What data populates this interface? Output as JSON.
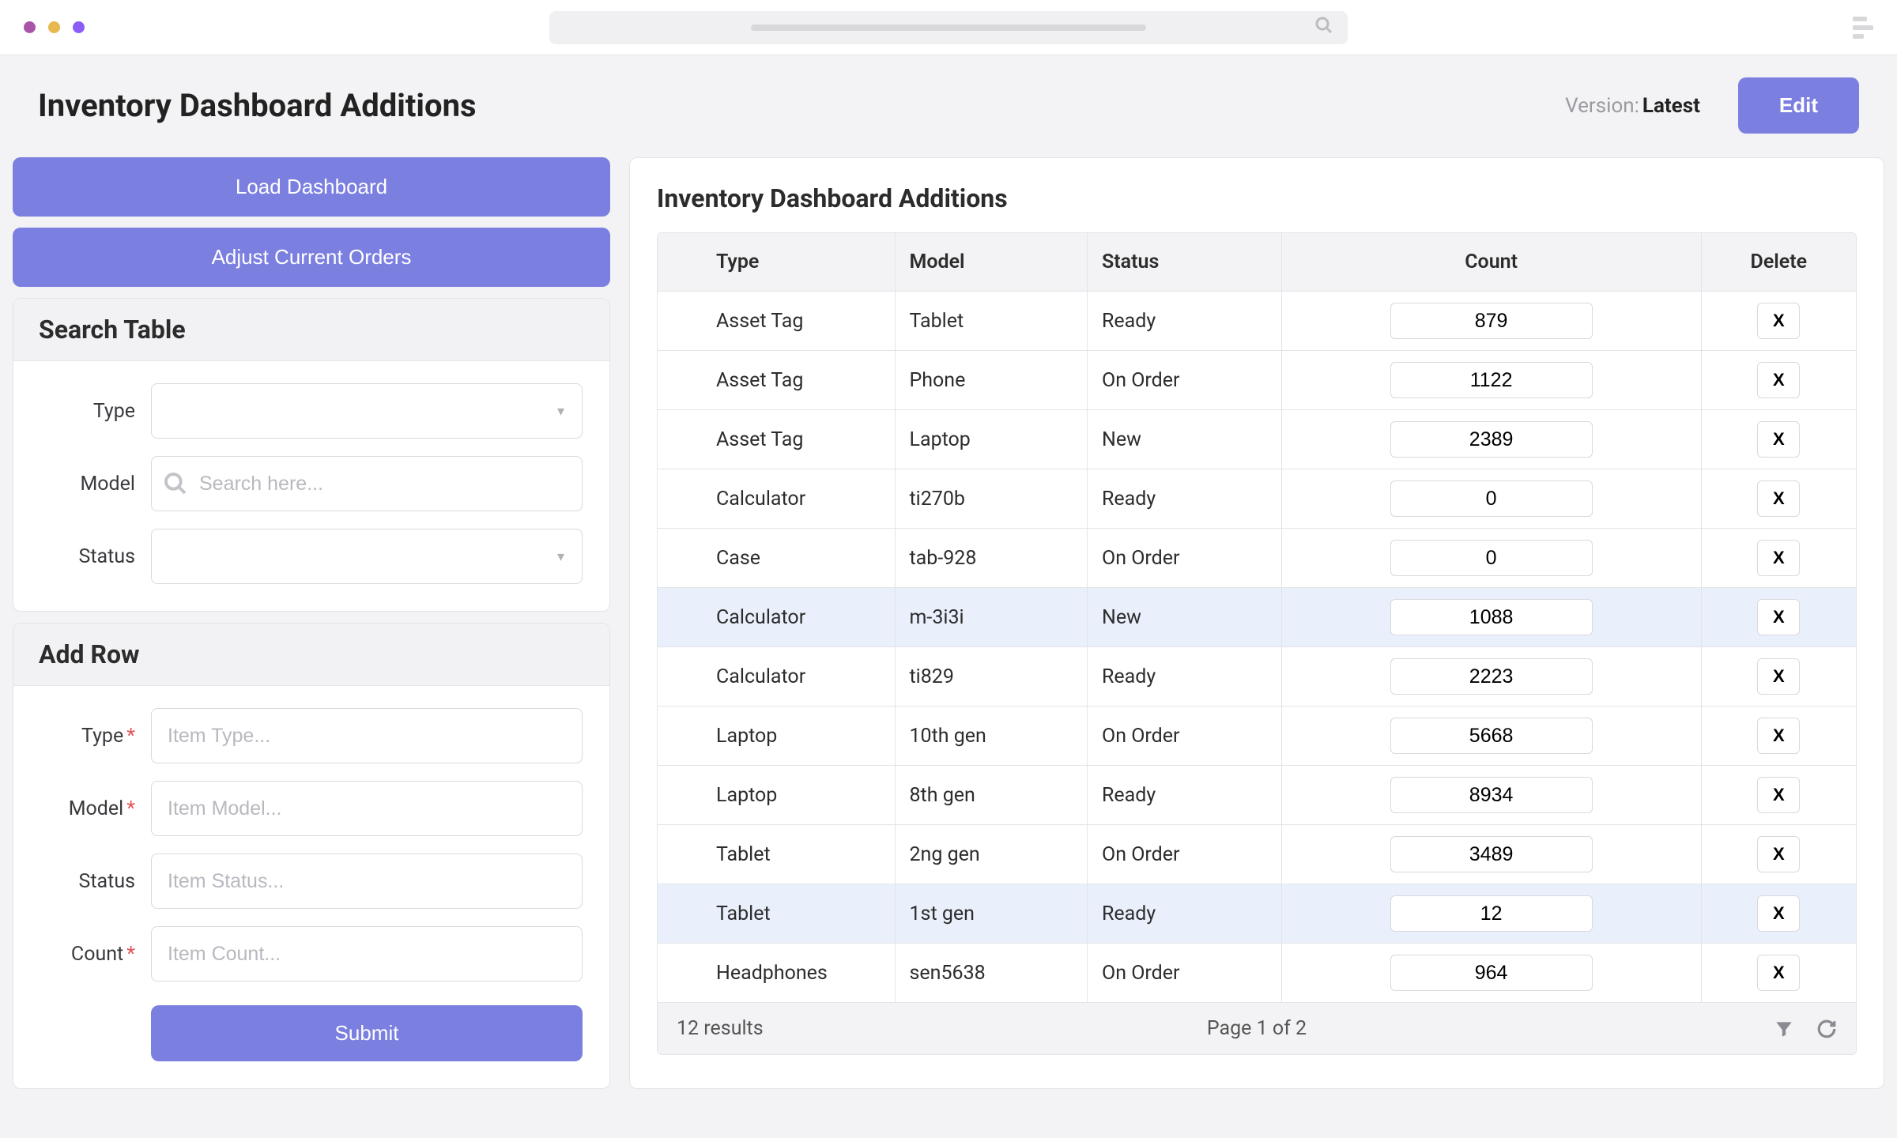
{
  "header": {
    "title": "Inventory Dashboard Additions",
    "version_label": "Version:",
    "version_value": "Latest",
    "edit_label": "Edit"
  },
  "sidebar": {
    "load_btn": "Load Dashboard",
    "adjust_btn": "Adjust Current Orders",
    "search": {
      "title": "Search Table",
      "type_label": "Type",
      "model_label": "Model",
      "model_placeholder": "Search here...",
      "status_label": "Status"
    },
    "addrow": {
      "title": "Add Row",
      "type_label": "Type",
      "type_placeholder": "Item Type...",
      "model_label": "Model",
      "model_placeholder": "Item Model...",
      "status_label": "Status",
      "status_placeholder": "Item Status...",
      "count_label": "Count",
      "count_placeholder": "Item Count...",
      "submit_label": "Submit"
    }
  },
  "main": {
    "title": "Inventory Dashboard Additions",
    "columns": [
      "Type",
      "Model",
      "Status",
      "Count",
      "Delete"
    ],
    "rows": [
      {
        "type": "Asset Tag",
        "model": "Tablet",
        "status": "Ready",
        "count": "879",
        "highlight": false
      },
      {
        "type": "Asset Tag",
        "model": "Phone",
        "status": "On Order",
        "count": "1122",
        "highlight": false
      },
      {
        "type": "Asset Tag",
        "model": "Laptop",
        "status": "New",
        "count": "2389",
        "highlight": false
      },
      {
        "type": "Calculator",
        "model": "ti270b",
        "status": "Ready",
        "count": "0",
        "highlight": false
      },
      {
        "type": "Case",
        "model": "tab-928",
        "status": "On Order",
        "count": "0",
        "highlight": false
      },
      {
        "type": "Calculator",
        "model": "m-3i3i",
        "status": "New",
        "count": "1088",
        "highlight": true
      },
      {
        "type": "Calculator",
        "model": "ti829",
        "status": "Ready",
        "count": "2223",
        "highlight": false
      },
      {
        "type": "Laptop",
        "model": "10th gen",
        "status": "On Order",
        "count": "5668",
        "highlight": false
      },
      {
        "type": "Laptop",
        "model": "8th gen",
        "status": "Ready",
        "count": "8934",
        "highlight": false
      },
      {
        "type": "Tablet",
        "model": "2ng gen",
        "status": "On Order",
        "count": "3489",
        "highlight": false
      },
      {
        "type": "Tablet",
        "model": "1st gen",
        "status": "Ready",
        "count": "12",
        "highlight": true
      },
      {
        "type": "Headphones",
        "model": "sen5638",
        "status": "On Order",
        "count": "964",
        "highlight": false
      }
    ],
    "delete_label": "X",
    "footer": {
      "results": "12 results",
      "page": "Page 1 of 2"
    }
  }
}
